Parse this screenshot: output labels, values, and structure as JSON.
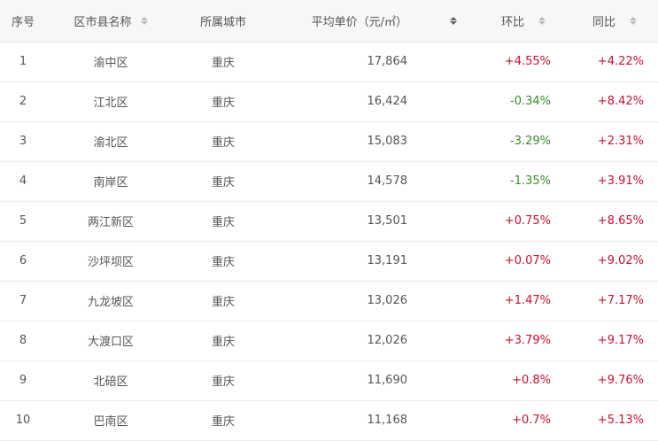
{
  "table": {
    "headers": {
      "idx": "序号",
      "district": "区市县名称",
      "city": "所属城市",
      "price": "平均单价（元/㎡）",
      "mom": "环比",
      "yoy": "同比"
    },
    "rows": [
      {
        "idx": "1",
        "district": "渝中区",
        "city": "重庆",
        "price": "17,864",
        "mom": "+4.55%",
        "yoy": "+4.22%"
      },
      {
        "idx": "2",
        "district": "江北区",
        "city": "重庆",
        "price": "16,424",
        "mom": "-0.34%",
        "yoy": "+8.42%"
      },
      {
        "idx": "3",
        "district": "渝北区",
        "city": "重庆",
        "price": "15,083",
        "mom": "-3.29%",
        "yoy": "+2.31%"
      },
      {
        "idx": "4",
        "district": "南岸区",
        "city": "重庆",
        "price": "14,578",
        "mom": "-1.35%",
        "yoy": "+3.91%"
      },
      {
        "idx": "5",
        "district": "两江新区",
        "city": "重庆",
        "price": "13,501",
        "mom": "+0.75%",
        "yoy": "+8.65%"
      },
      {
        "idx": "6",
        "district": "沙坪坝区",
        "city": "重庆",
        "price": "13,191",
        "mom": "+0.07%",
        "yoy": "+9.02%"
      },
      {
        "idx": "7",
        "district": "九龙坡区",
        "city": "重庆",
        "price": "13,026",
        "mom": "+1.47%",
        "yoy": "+7.17%"
      },
      {
        "idx": "8",
        "district": "大渡口区",
        "city": "重庆",
        "price": "12,026",
        "mom": "+3.79%",
        "yoy": "+9.17%"
      },
      {
        "idx": "9",
        "district": "北碚区",
        "city": "重庆",
        "price": "11,690",
        "mom": "+0.8%",
        "yoy": "+9.76%"
      },
      {
        "idx": "10",
        "district": "巴南区",
        "city": "重庆",
        "price": "11,168",
        "mom": "+0.7%",
        "yoy": "+5.13%"
      }
    ]
  },
  "colors": {
    "positive": "#c8102e",
    "negative": "#3a8a2a",
    "header_bg": "#f7f7f7"
  }
}
